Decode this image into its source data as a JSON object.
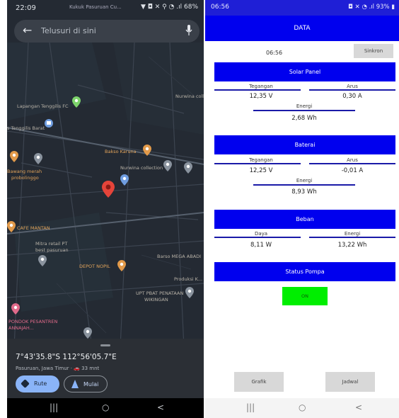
{
  "left_phone": {
    "status": {
      "time": "22:09",
      "notification": "Kukuk Pasuruan Cu...",
      "icons": "▼ ◘ ✕ ⚲ ◔ .ıl 68%"
    },
    "search": {
      "placeholder": "Telusuri di sini",
      "back_icon": "arrow-left-icon",
      "mic_icon": "mic-icon"
    },
    "map_labels": {
      "lapangan": "Lapangan Tenggilis FC",
      "nurwina_top": "Nurwina coll",
      "tenggilis": "s Tenggilis Barat",
      "bakso": "Bakso Karuna",
      "nurwina": "Nurwina collection",
      "bawang_1": "Bawang merah",
      "bawang_2": "probolinggo",
      "cafe": "CAFE MANTAN",
      "mitra_1": "Mitra retail PT",
      "mitra_2": "best pasuruan",
      "depot": "DEPOT NOPIL",
      "barso": "Barso MEGA ABADI",
      "produksi": "Produksi K...",
      "upt_1": "UPT PBAT PENATAAN",
      "upt_2": "WIKINGAN",
      "pondok_1": "PONDOK PESANTREN",
      "pondok_2": "ANNAJAH..."
    },
    "coordinates": "7°43'35.8\"S 112°56'05.7\"E",
    "place": "Pasuruan, Jawa Timur · 🚗 33 mnt",
    "buttons": {
      "rute": "Rute",
      "mulai": "Mulai"
    },
    "nav": {
      "recent": "|||",
      "home": "○",
      "back": "<"
    }
  },
  "right_phone": {
    "status": {
      "time": "06:56",
      "icons": "◘ ✕ ◔ .ıl 93% ▮"
    },
    "appbar_title": "DATA",
    "clock": "06:56",
    "sinkron_label": "Sinkron",
    "solar": {
      "title": "Solar Panel",
      "tegangan_label": "Tegangan",
      "tegangan": "12,35 V",
      "arus_label": "Arus",
      "arus": "0,30 A",
      "energi_label": "Energi",
      "energi": "2,68 Wh"
    },
    "baterai": {
      "title": "Baterai",
      "tegangan_label": "Tegangan",
      "tegangan": "12,25 V",
      "arus_label": "Arus",
      "arus": "-0,01 A",
      "energi_label": "Energi",
      "energi": "8,93 Wh"
    },
    "beban": {
      "title": "Beban",
      "daya_label": "Daya",
      "daya": "8,11 W",
      "energi_label": "Energi",
      "energi": "13,22 Wh"
    },
    "pompa": {
      "title": "Status Pompa",
      "button": "ON"
    },
    "buttons": {
      "grafik": "Grafik",
      "jadwal": "Jadwal"
    },
    "nav": {
      "recent": "|||",
      "home": "○",
      "back": "<"
    },
    "colors": {
      "header": "#0000ee",
      "on_button": "#00ee00",
      "button_gray": "#d8d8d8"
    }
  }
}
